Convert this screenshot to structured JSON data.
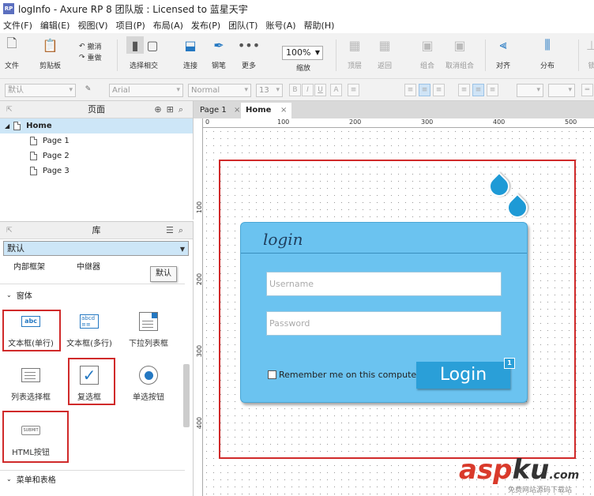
{
  "window": {
    "title": "logInfo - Axure RP 8 团队版 : Licensed to 蓝星天宇",
    "icon_text": "RP"
  },
  "menu": [
    "文件(F)",
    "编辑(E)",
    "视图(V)",
    "项目(P)",
    "布局(A)",
    "发布(P)",
    "团队(T)",
    "账号(A)",
    "帮助(H)"
  ],
  "toolbar": {
    "file": "文件",
    "clipboard": "剪贴板",
    "undo": "撤消",
    "redo": "重做",
    "select": "选择相交",
    "connect": "连接",
    "pen": "钢笔",
    "more": "更多",
    "zoom": "100%",
    "zoom_label": "缩放",
    "top": "顶层",
    "back": "返回",
    "group": "组合",
    "ungroup": "取消组合",
    "align": "对齐",
    "distribute": "分布",
    "lock": "锁"
  },
  "formatbar": {
    "style": "默认",
    "font": "Arial",
    "weight": "Normal",
    "size": "13"
  },
  "pages_panel": {
    "title": "页面",
    "home": "Home",
    "pages": [
      "Page 1",
      "Page 2",
      "Page 3"
    ]
  },
  "library": {
    "title": "库",
    "selected": "默认",
    "tooltip": "默认",
    "top_items": [
      "内部框架",
      "中继器"
    ],
    "section_form": "窗体",
    "section_menu": "菜单和表格",
    "items": {
      "text_field": "文本框(单行)",
      "text_area": "文本框(多行)",
      "dropdown": "下拉列表框",
      "list_box": "列表选择框",
      "checkbox": "复选框",
      "radio": "单选按钮",
      "html_button": "HTML按钮",
      "submit_icon": "SUBMIT"
    }
  },
  "tabs": [
    {
      "label": "Page 1"
    },
    {
      "label": "Home"
    }
  ],
  "ruler": {
    "h": [
      "0",
      "100",
      "200",
      "300",
      "400",
      "500"
    ],
    "v": [
      "100",
      "200",
      "300",
      "400"
    ]
  },
  "login": {
    "title": "login",
    "username_placeholder": "Username",
    "password_placeholder": "Password",
    "remember": "Remember me on this computer",
    "button": "Login",
    "badge": "1"
  },
  "watermark": {
    "main_a": "asp",
    "main_b": "ku",
    "main_c": ".com",
    "sub": "免费网站源码下载站"
  },
  "colors": {
    "card": "#6bc3f0",
    "button": "#2a9fd8",
    "selection": "#d02a2a"
  }
}
